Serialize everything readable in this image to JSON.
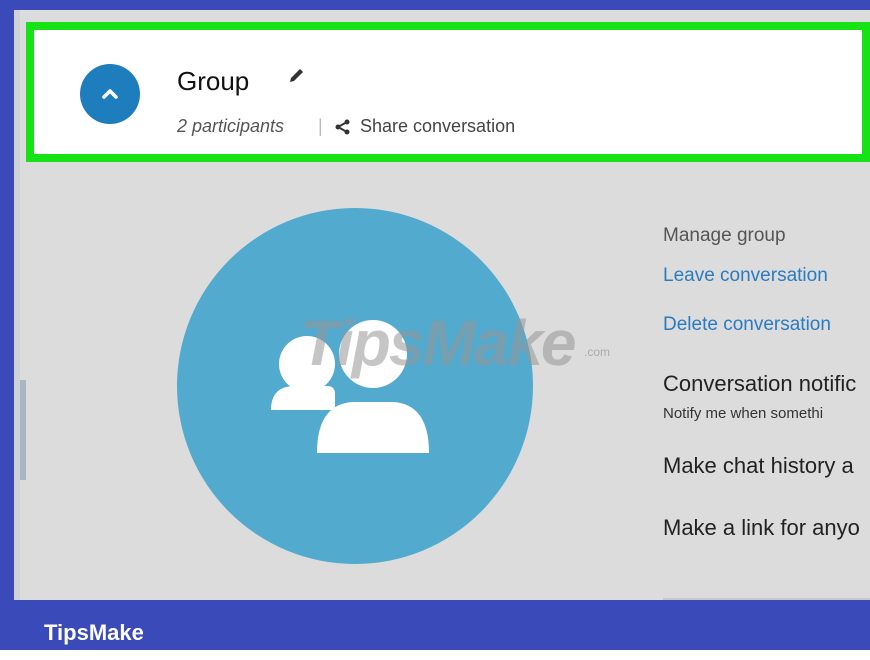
{
  "header": {
    "group_name": "Group",
    "participants": "2 participants",
    "separator": "|",
    "share_label": "Share conversation"
  },
  "icons": {
    "collapse": "chevron-up-icon",
    "edit": "pencil-icon",
    "share": "share-icon",
    "avatar": "group-people-icon"
  },
  "watermark": {
    "text": "TipsMake",
    "suffix": ".com"
  },
  "panel": {
    "manage_title": "Manage group",
    "leave": "Leave conversation",
    "delete": "Delete conversation",
    "notifications": "Conversation notific",
    "notifications_sub": "Notify me when somethi",
    "chat_history": "Make chat history a",
    "link": "Make a link for anyo"
  },
  "footer": {
    "brand": "TipsMake"
  },
  "colors": {
    "frame": "#3a4ab8",
    "highlight": "#16e316",
    "accent": "#1e7dbd",
    "avatar": "#52aacf",
    "link": "#2b7bc1"
  }
}
